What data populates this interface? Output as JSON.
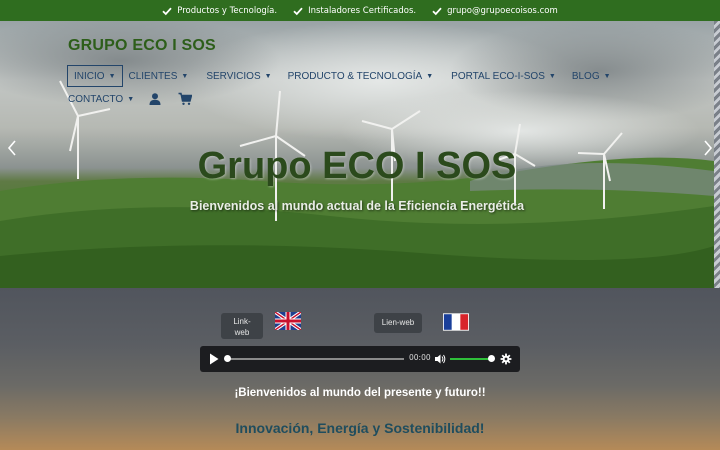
{
  "topbar": {
    "items": [
      {
        "icon": "check-icon",
        "label": "Productos y Tecnología."
      },
      {
        "icon": "check-icon",
        "label": "Instaladores Certificados."
      },
      {
        "icon": "check-icon",
        "label": "grupo@grupoecoisos.com"
      }
    ]
  },
  "header": {
    "brand": "GRUPO ECO I SOS",
    "nav": [
      {
        "label": "INICIO",
        "caret": "▼",
        "active": true
      },
      {
        "label": "CLIENTES",
        "caret": "▼"
      },
      {
        "label": "SERVICIOS",
        "caret": "▼"
      },
      {
        "label": "PRODUCTO & TECNOLOGÍA",
        "caret": "▼"
      },
      {
        "label": "PORTAL ECO-I-SOS",
        "caret": "▼"
      },
      {
        "label": "BLOG",
        "caret": "▼"
      },
      {
        "label": "CONTACTO",
        "caret": "▼"
      }
    ],
    "icons": [
      "user-icon",
      "cart-icon"
    ]
  },
  "hero": {
    "title": "Grupo ECO I SOS",
    "subtitle": "Bienvenidos al mundo actual de la Eficiencia Energética"
  },
  "links": {
    "en_label": "Link-web",
    "en_line1": "Link-",
    "en_line2": "web",
    "fr_label": "Lien-web"
  },
  "audio": {
    "time": "00:00",
    "progress": 0,
    "volume": 1.0
  },
  "content": {
    "welcome": "¡Bienvenidos al mundo del presente y futuro!!",
    "tagline": "Innovación, Energía y Sostenibilidad!"
  },
  "colors": {
    "topbar": "#2f6d1f",
    "brand": "#2d5e1a",
    "nav_text": "#23456a",
    "tagline": "#1f4d5e",
    "volume": "#2fbf3a"
  }
}
